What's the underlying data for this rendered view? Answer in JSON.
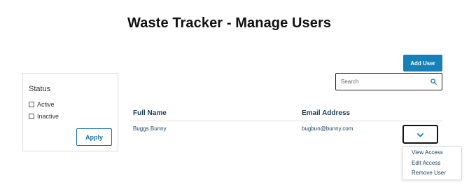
{
  "header": {
    "title": "Waste Tracker - Manage Users"
  },
  "filter": {
    "title": "Status",
    "options": [
      {
        "label": "Active",
        "checked": false
      },
      {
        "label": "Inactive",
        "checked": false
      }
    ],
    "apply_label": "Apply"
  },
  "toolbar": {
    "add_user_label": "Add User"
  },
  "search": {
    "placeholder": "Search",
    "value": "",
    "icon": "search-icon"
  },
  "table": {
    "columns": [
      "Full Name",
      "Email Address"
    ],
    "rows": [
      {
        "full_name": "Buggs Bunny",
        "email": "bugbun@bunny.com"
      }
    ]
  },
  "row_menu": {
    "icon": "chevron-down-icon",
    "items": [
      "View Access",
      "Edit Access",
      "Remove User"
    ]
  },
  "colors": {
    "accent": "#1581b8",
    "header_text": "#1a3d5c"
  }
}
